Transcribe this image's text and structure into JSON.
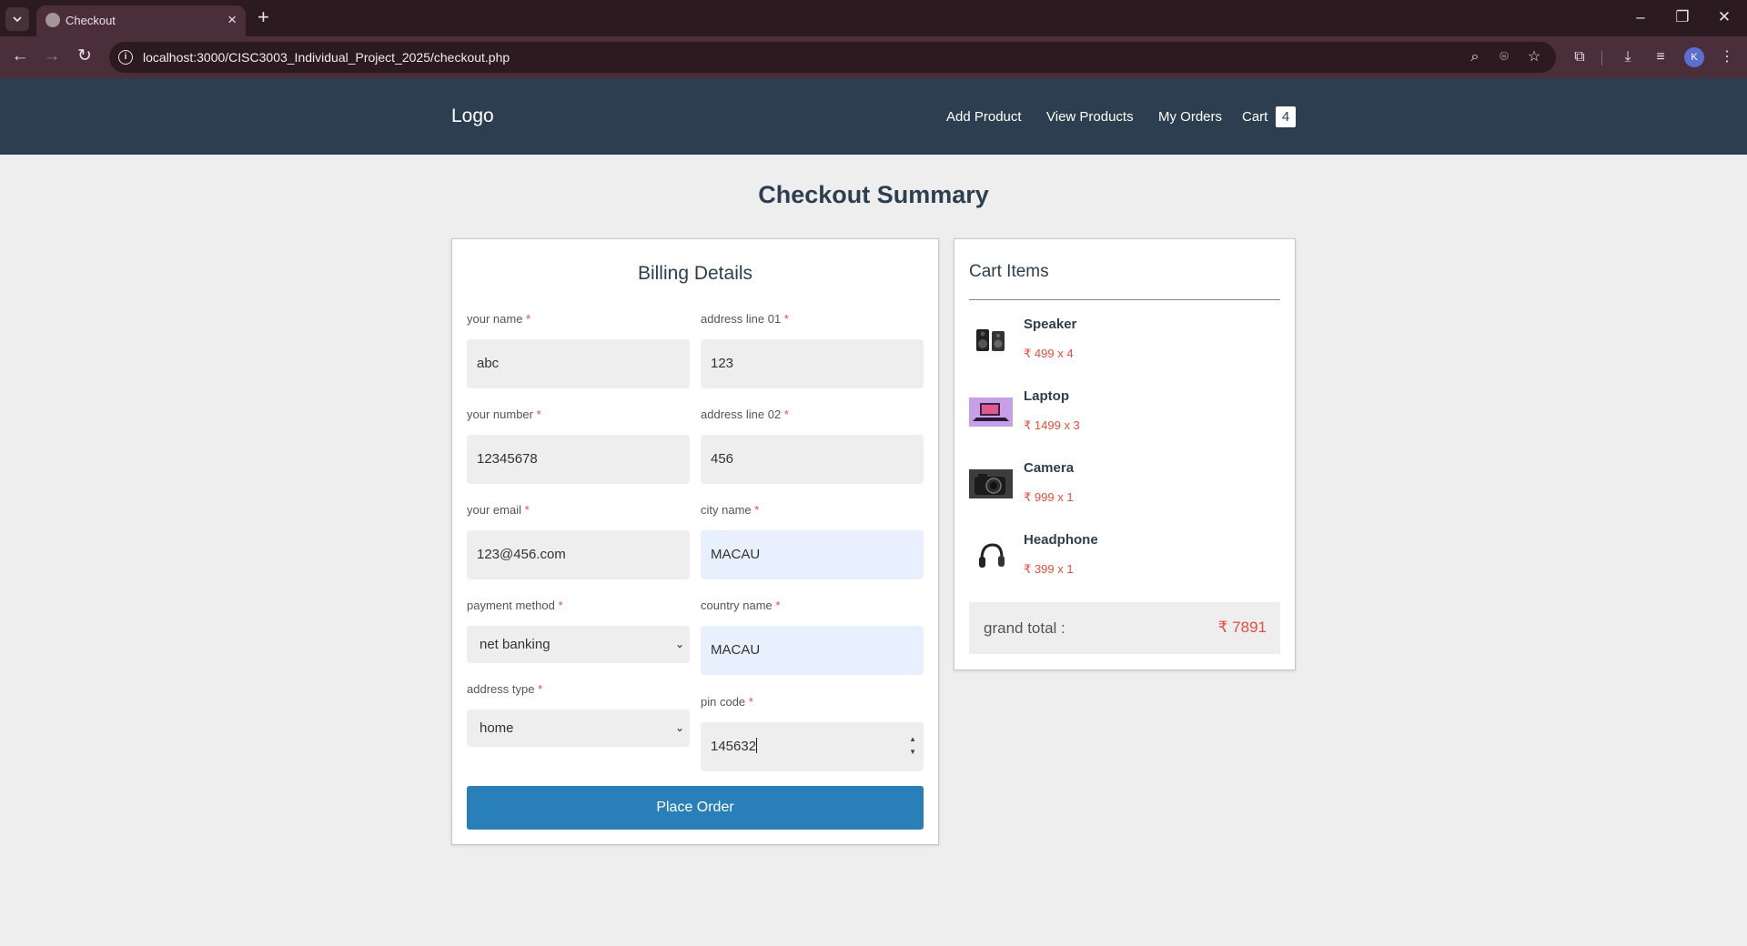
{
  "browser": {
    "tab_title": "Checkout",
    "url": "localhost:3000/CISC3003_Individual_Project_2025/checkout.php",
    "profile_initial": "K"
  },
  "header": {
    "logo": "Logo",
    "nav": [
      "Add Product",
      "View Products",
      "My Orders",
      "Cart"
    ],
    "cart_count": "4"
  },
  "page_title": "Checkout Summary",
  "billing": {
    "heading": "Billing Details",
    "required_mark": "*",
    "fields": {
      "name": {
        "label": "your name",
        "value": "abc"
      },
      "number": {
        "label": "your number",
        "value": "12345678"
      },
      "email": {
        "label": "your email",
        "value": "123@456.com"
      },
      "payment_method": {
        "label": "payment method",
        "value": "net banking"
      },
      "address_type": {
        "label": "address type",
        "value": "home"
      },
      "address1": {
        "label": "address line 01",
        "value": "123"
      },
      "address2": {
        "label": "address line 02",
        "value": "456"
      },
      "city": {
        "label": "city name",
        "value": "MACAU"
      },
      "country": {
        "label": "country name",
        "value": "MACAU"
      },
      "pin": {
        "label": "pin code",
        "value": "145632"
      }
    },
    "submit_label": "Place Order"
  },
  "cart": {
    "heading": "Cart Items",
    "currency_symbol": "₹",
    "items": [
      {
        "name": "Speaker",
        "price": "499 x 4",
        "icon": "speaker-icon"
      },
      {
        "name": "Laptop",
        "price": "1499 x 3",
        "icon": "laptop-icon"
      },
      {
        "name": "Camera",
        "price": "999 x 1",
        "icon": "camera-icon"
      },
      {
        "name": "Headphone",
        "price": "399 x 1",
        "icon": "headphone-icon"
      }
    ],
    "grand_total_label": "grand total :",
    "grand_total_value": "7891"
  },
  "colors": {
    "header_bg": "#2c3e50",
    "accent_button": "#2980b9",
    "price": "#e74c3c",
    "required": "#e74c3c",
    "autofill_bg": "#e8f0fe"
  }
}
